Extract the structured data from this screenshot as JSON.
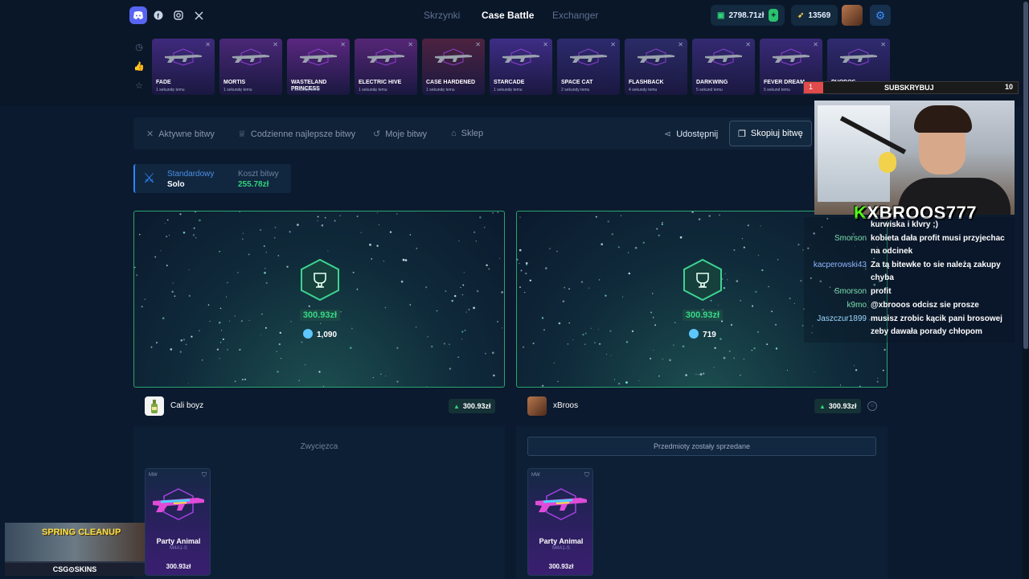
{
  "nav": {
    "links": [
      "Skrzynki",
      "Case Battle",
      "Exchanger"
    ],
    "balance": "2798.71zł",
    "coins": "13569"
  },
  "drops": [
    {
      "name": "FADE",
      "time": "1 sekundę temu",
      "bg": "#3f2a7c"
    },
    {
      "name": "MORTIS",
      "time": "1 sekundę temu",
      "bg": "#4a2877"
    },
    {
      "name": "WASTELAND PRINCESS",
      "time": "1 sekundę temu",
      "bg": "#5a2780"
    },
    {
      "name": "ELECTRIC HIVE",
      "time": "1 sekundę temu",
      "bg": "#552676"
    },
    {
      "name": "CASE HARDENED",
      "time": "1 sekundę temu",
      "bg": "#4d2340"
    },
    {
      "name": "STARCADE",
      "time": "1 sekundę temu",
      "bg": "#3e2d86"
    },
    {
      "name": "SPACE CAT",
      "time": "2 sekundy temu",
      "bg": "#2d2a6e"
    },
    {
      "name": "FLASHBACK",
      "time": "4 sekundy temu",
      "bg": "#2b2c68"
    },
    {
      "name": "DARKWING",
      "time": "5 sekund temu",
      "bg": "#332a72"
    },
    {
      "name": "FEVER DREAM",
      "time": "5 sekund temu",
      "bg": "#3a2a78"
    },
    {
      "name": "PHOBOS",
      "time": "5 sekund temu",
      "bg": "#2f2b70"
    }
  ],
  "toolbar": {
    "active": "Aktywne bitwy",
    "daily": "Codzienne najlepsze bitwy",
    "mine": "Moje bitwy",
    "shop": "Sklep",
    "share": "Udostępnij",
    "copy": "Skopiuj bitwę"
  },
  "mode": {
    "label": "Standardowy",
    "value": "Solo",
    "cost_label": "Koszt bitwy",
    "cost": "255.78zł"
  },
  "players": [
    {
      "name": "Cali boyz",
      "amount": "300.93zł",
      "coins": "1,090",
      "status": "Zwycięzca",
      "item": {
        "wear": "MW",
        "name": "Party Animal",
        "type": "M4A1-S",
        "price": "300.93zł"
      }
    },
    {
      "name": "xBroos",
      "amount": "300.93zł",
      "coins": "719",
      "status": "Przedmioty zostały sprzedane",
      "item": {
        "wear": "MW",
        "name": "Party Animal",
        "type": "M4A1-S",
        "price": "300.93zł"
      }
    }
  ],
  "stream": {
    "sub_left": "1",
    "sub_label": "SUBSKRYBUJ",
    "sub_right": "10",
    "streamer_k": "K",
    "streamer": "XBROOS777",
    "chat": [
      {
        "user": "",
        "msg": "kurwiska i klvry ;)",
        "color": "#ffffff"
      },
      {
        "user": "Smorson",
        "msg": "kobieta dała profit musi przyjechac na odcinek",
        "color": "#7fe0b0"
      },
      {
        "user": "kacperowski43",
        "msg": "Za tą bitewke to sie należą zakupy chyba",
        "color": "#8fb8ff"
      },
      {
        "user": "Smorson",
        "msg": "profit",
        "color": "#7fe0b0"
      },
      {
        "user": "k9mo",
        "msg": "@xbrooos odcisz sie prosze",
        "color": "#7fe0b0"
      },
      {
        "user": "Jaszczur1899",
        "msg": "musisz zrobic kącik pani brosowej zeby dawała porady chłopom",
        "color": "#9fd8ff"
      }
    ],
    "promo_title": "SPRING CLEANUP",
    "promo_brand": "CSG⊙SKINS"
  },
  "colors": {
    "accent": "#2d86ff",
    "win": "#38d88a",
    "border_win": "#2aa46f"
  }
}
